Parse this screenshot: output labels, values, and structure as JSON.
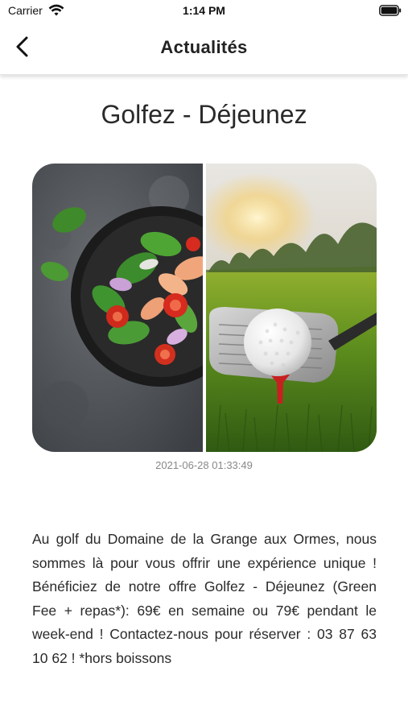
{
  "status_bar": {
    "carrier": "Carrier",
    "time": "1:14 PM",
    "wifi_icon": "wifi-icon",
    "battery_icon": "battery-icon"
  },
  "nav": {
    "title": "Actualités",
    "back_icon": "chevron-left-icon"
  },
  "article": {
    "title": "Golfez - Déjeunez",
    "image_description": "split image: salad bowl and golf ball on tee",
    "timestamp": "2021-06-28 01:33:49",
    "body": "Au golf du Domaine de la Grange aux Ormes, nous sommes là pour vous offrir une expérience unique ! Bénéficiez de notre offre Golfez - Déjeunez (Green Fee + repas*): 69€ en semaine ou 79€ pendant le week-end ! Contactez-nous pour réserver : 03 87 63 10 62 ! *hors boissons"
  },
  "colors": {
    "background": "#ffffff",
    "text": "#2a2a2a",
    "timestamp": "#888888"
  }
}
